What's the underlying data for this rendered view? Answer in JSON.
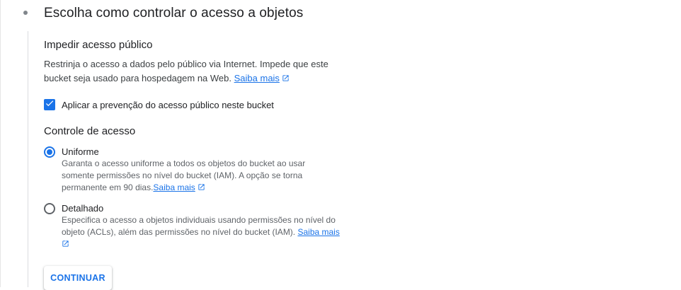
{
  "step": {
    "title": "Escolha como controlar o acesso a objetos"
  },
  "public_access": {
    "heading": "Impedir acesso público",
    "description_line1": "Restrinja o acesso a dados pelo público via Internet. Impede que este",
    "description_line2": "bucket seja usado para hospedagem na Web.",
    "learn_more": "Saiba mais",
    "checkbox_label": "Aplicar a prevenção do acesso público neste bucket",
    "checkbox_checked": true
  },
  "access_control": {
    "heading": "Controle de acesso",
    "options": [
      {
        "label": "Uniforme",
        "selected": true,
        "desc_line1": "Garanta o acesso uniforme a todos os objetos do bucket ao usar",
        "desc_line2": "somente permissões no nível do bucket (IAM). A opção se torna",
        "desc_line3": "permanente em 90 dias.",
        "learn_more": "Saiba mais"
      },
      {
        "label": "Detalhado",
        "selected": false,
        "desc_line1": "Especifica o acesso a objetos individuais usando permissões no nível do",
        "desc_line2": "objeto (ACLs), além das permissões no nível do bucket (IAM).",
        "learn_more": "Saiba mais"
      }
    ]
  },
  "actions": {
    "continue_label": "CONTINUAR"
  },
  "colors": {
    "accent": "#1a73e8",
    "text": "#202124",
    "secondary_text": "#5f6368"
  },
  "icons": {
    "external_link": "open-in-new-icon",
    "checkbox": "check-icon"
  }
}
